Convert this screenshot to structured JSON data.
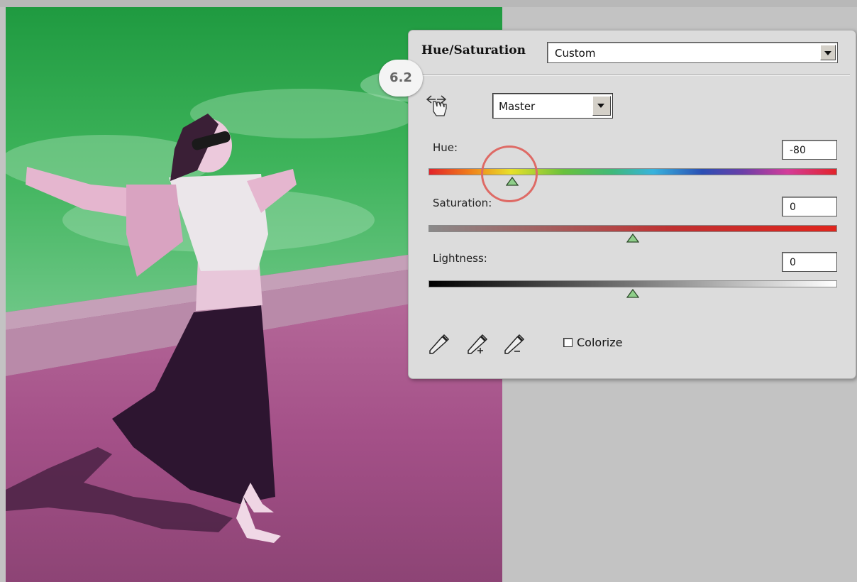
{
  "panel": {
    "title": "Hue/Saturation",
    "preset": "Custom",
    "channel": "Master",
    "step_badge": "6.2",
    "hue": {
      "label": "Hue:",
      "value": "-80",
      "slider_fraction": 0.205
    },
    "saturation": {
      "label": "Saturation:",
      "value": "0",
      "slider_fraction": 0.5
    },
    "lightness": {
      "label": "Lightness:",
      "value": "0",
      "slider_fraction": 0.5
    },
    "colorize_label": "Colorize",
    "colorize_checked": false,
    "tools": [
      "eyedropper-icon",
      "eyedropper-plus-icon",
      "eyedropper-minus-icon"
    ],
    "highlight_color": "#de6a65"
  },
  "colors": {
    "sky": "#2fa84f",
    "sand": "#a85088",
    "panel_bg": "#dcdcdc"
  }
}
